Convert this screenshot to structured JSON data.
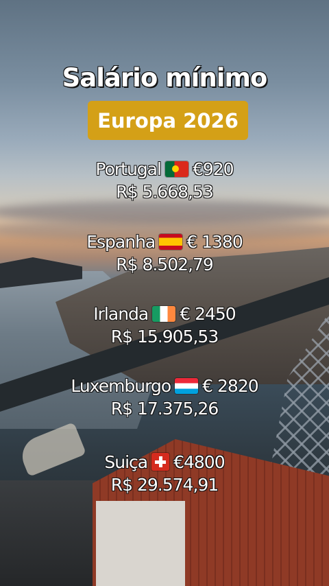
{
  "title": "Salário mínimo",
  "badge": "Europa 2026",
  "colors": {
    "badge_bg": "#d4a017",
    "text": "#ffffff",
    "outline": "#111111"
  },
  "entries": [
    {
      "country": "Portugal",
      "flag": "portugal-flag-icon",
      "euro": "€920",
      "brl": "R$ 5.668,53"
    },
    {
      "country": "Espanha",
      "flag": "spain-flag-icon",
      "euro": "€ 1380",
      "brl": "R$ 8.502,79"
    },
    {
      "country": "Irlanda",
      "flag": "ireland-flag-icon",
      "euro": "€ 2450",
      "brl": "R$ 15.905,53"
    },
    {
      "country": "Luxemburgo",
      "flag": "luxembourg-flag-icon",
      "euro": "€ 2820",
      "brl": "R$ 17.375,26"
    },
    {
      "country": "Suiça",
      "flag": "switzerland-flag-icon",
      "euro": "€4800",
      "brl": "R$ 29.574,91"
    }
  ]
}
